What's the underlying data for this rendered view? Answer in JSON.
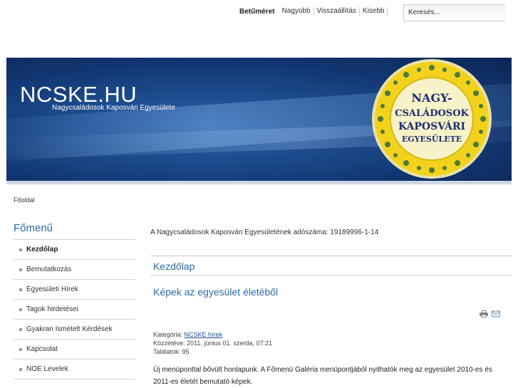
{
  "toolbar": {
    "fontsize_title": "Betűméret",
    "larger": "Nagyobb",
    "reset": "Visszaállítás",
    "smaller": "Kisebb",
    "search_placeholder": "Keresés..."
  },
  "header": {
    "title": "NCSKE.HU",
    "slogan": "Nagycsaládosok Kaposvári Egyesülete",
    "logo_text": [
      "NAGY-",
      "CSALÁDOSOK",
      "KAPOSVÁRI",
      "EGYESÜLETE"
    ]
  },
  "breadcrumb": "Főoldal",
  "sidebar": {
    "heading": "Főmenű",
    "items": [
      {
        "label": "Kezdőlap"
      },
      {
        "label": "Bemutatkozás"
      },
      {
        "label": "Egyesületi Hírek"
      },
      {
        "label": "Tagok hirdetései"
      },
      {
        "label": "Gyakran Ismételt Kérdések"
      },
      {
        "label": "Kapcsolat"
      },
      {
        "label": "NOE Levelek"
      }
    ]
  },
  "main": {
    "tax_notice": "A Nagycsaládosok Kaposvári Egyesületének adószáma: 19189996-1-14",
    "section_title": "Kezdőlap",
    "article": {
      "title": "Képek az egyesület életéből",
      "category_label": "Kategória:",
      "category_link": "NCSKE hírek",
      "published": "Közzétéve: 2011. június 01. szerda, 07:21",
      "hits": "Találatok: 95",
      "body": "Új menüponttal bővült honlapunk. A Főmenü Galéria menüpontjából nyithatók meg az egyesület 2010-es és 2011-es életét bemutató képek."
    },
    "icons": [
      "print-icon",
      "email-icon"
    ]
  },
  "colors": {
    "accent": "#2f6aa7",
    "header_blue": "#1c4b8d",
    "logo_yellow": "#f2d21c"
  }
}
